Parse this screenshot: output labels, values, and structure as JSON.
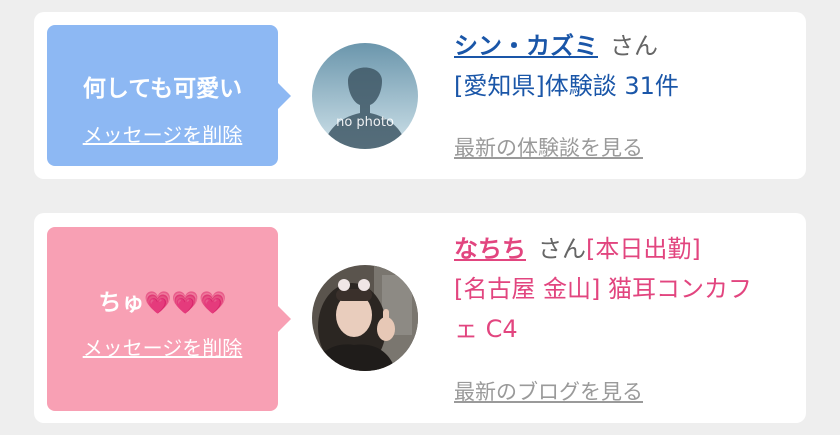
{
  "cards": [
    {
      "message": "何しても可愛い",
      "delete_label": "メッセージを削除",
      "avatar_text": "no photo",
      "name": "シン・カズミ",
      "honorific": "さん",
      "detail": "[愛知県]体験談 31件",
      "link_label": "最新の体験談を見る"
    },
    {
      "message": "ちゅ",
      "message_icons": "💗💗💗",
      "delete_label": "メッセージを削除",
      "name": "なちち",
      "honorific": "さん",
      "status": "[本日出勤]",
      "detail_line1": "[名古屋 金山] 猫耳コンカフ",
      "detail_line2": "ェ C4",
      "link_label": "最新のブログを見る"
    }
  ],
  "colors": {
    "bubble_blue": "#8db8f3",
    "bubble_pink": "#f8a0b4",
    "text_blue": "#1a56a8",
    "text_pink": "#e2457f",
    "link_gray": "#9a9a9a"
  }
}
